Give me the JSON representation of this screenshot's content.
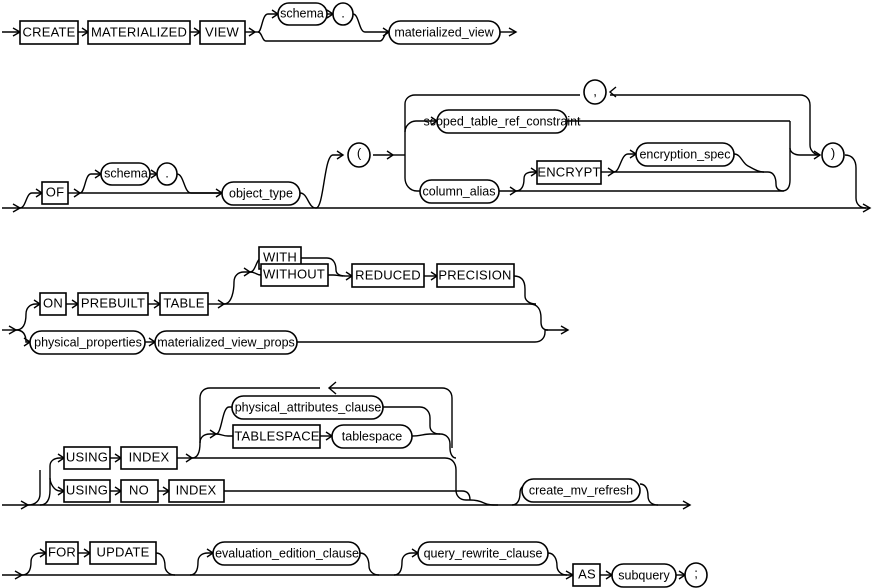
{
  "diagram": {
    "title": "create_materialized_view",
    "type": "railroad-syntax-diagram",
    "colors": {
      "background": "#ffffff",
      "stroke": "#000000",
      "text": "#000000"
    },
    "rows": [
      {
        "id": "row-1",
        "nodes": [
          {
            "id": "create",
            "label": "CREATE",
            "shape": "box"
          },
          {
            "id": "materialized",
            "label": "MATERIALIZED",
            "shape": "box"
          },
          {
            "id": "view",
            "label": "VIEW",
            "shape": "box"
          },
          {
            "id": "schema-1",
            "label": "schema",
            "shape": "oval"
          },
          {
            "id": "dot-1",
            "label": ".",
            "shape": "circle"
          },
          {
            "id": "materialized-view",
            "label": "materialized_view",
            "shape": "oval"
          }
        ]
      },
      {
        "id": "row-2",
        "nodes": [
          {
            "id": "of",
            "label": "OF",
            "shape": "box"
          },
          {
            "id": "schema-2",
            "label": "schema",
            "shape": "oval"
          },
          {
            "id": "dot-2",
            "label": ".",
            "shape": "circle"
          },
          {
            "id": "object-type",
            "label": "object_type",
            "shape": "oval"
          },
          {
            "id": "lparen",
            "label": "(",
            "shape": "circle"
          },
          {
            "id": "comma",
            "label": ",",
            "shape": "circle"
          },
          {
            "id": "scoped-table-ref-constraint",
            "label": "scoped_table_ref_constraint",
            "shape": "oval"
          },
          {
            "id": "column-alias",
            "label": "column_alias",
            "shape": "oval"
          },
          {
            "id": "encrypt",
            "label": "ENCRYPT",
            "shape": "box"
          },
          {
            "id": "encryption-spec",
            "label": "encryption_spec",
            "shape": "oval"
          },
          {
            "id": "rparen",
            "label": ")",
            "shape": "circle"
          }
        ]
      },
      {
        "id": "row-3",
        "nodes": [
          {
            "id": "on",
            "label": "ON",
            "shape": "box"
          },
          {
            "id": "prebuilt",
            "label": "PREBUILT",
            "shape": "box"
          },
          {
            "id": "table",
            "label": "TABLE",
            "shape": "box"
          },
          {
            "id": "with",
            "label": "WITH",
            "shape": "box"
          },
          {
            "id": "without",
            "label": "WITHOUT",
            "shape": "box"
          },
          {
            "id": "reduced",
            "label": "REDUCED",
            "shape": "box"
          },
          {
            "id": "precision",
            "label": "PRECISION",
            "shape": "box"
          },
          {
            "id": "physical-properties",
            "label": "physical_properties",
            "shape": "oval"
          },
          {
            "id": "materialized-view-props",
            "label": "materialized_view_props",
            "shape": "oval"
          }
        ]
      },
      {
        "id": "row-4",
        "nodes": [
          {
            "id": "using-1",
            "label": "USING",
            "shape": "box"
          },
          {
            "id": "index-1",
            "label": "INDEX",
            "shape": "box"
          },
          {
            "id": "using-2",
            "label": "USING",
            "shape": "box"
          },
          {
            "id": "no",
            "label": "NO",
            "shape": "box"
          },
          {
            "id": "index-2",
            "label": "INDEX",
            "shape": "box"
          },
          {
            "id": "physical-attributes-clause",
            "label": "physical_attributes_clause",
            "shape": "oval"
          },
          {
            "id": "tablespace-kw",
            "label": "TABLESPACE",
            "shape": "box"
          },
          {
            "id": "tablespace-var",
            "label": "tablespace",
            "shape": "oval"
          },
          {
            "id": "create-mv-refresh",
            "label": "create_mv_refresh",
            "shape": "oval"
          }
        ]
      },
      {
        "id": "row-5",
        "nodes": [
          {
            "id": "for",
            "label": "FOR",
            "shape": "box"
          },
          {
            "id": "update",
            "label": "UPDATE",
            "shape": "box"
          },
          {
            "id": "evaluation-edition-clause",
            "label": "evaluation_edition_clause",
            "shape": "oval"
          },
          {
            "id": "query-rewrite-clause",
            "label": "query_rewrite_clause",
            "shape": "oval"
          },
          {
            "id": "as",
            "label": "AS",
            "shape": "box"
          },
          {
            "id": "subquery",
            "label": "subquery",
            "shape": "oval"
          },
          {
            "id": "semicolon",
            "label": ";",
            "shape": "circle"
          }
        ]
      }
    ]
  }
}
